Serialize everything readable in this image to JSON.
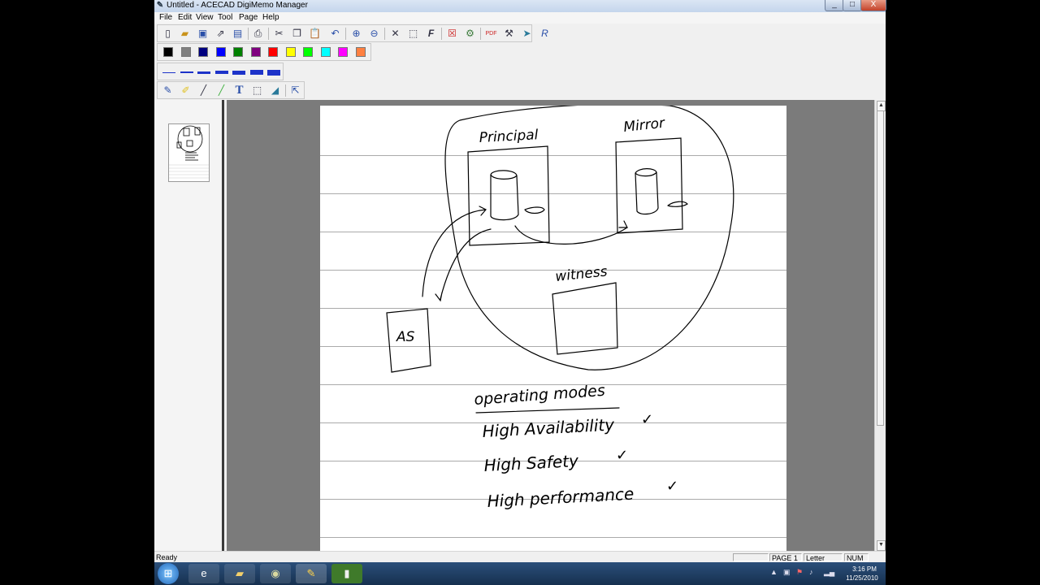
{
  "window": {
    "title": "Untitled - ACECAD DigiMemo Manager",
    "app_icon": "digimemo-app-icon",
    "controls": {
      "minimize": "_",
      "maximize": "□",
      "close": "X"
    }
  },
  "menu": [
    "File",
    "Edit",
    "View",
    "Tool",
    "Page",
    "Help"
  ],
  "toolbar_icons": [
    "new-icon",
    "open-icon",
    "save-icon",
    "export-icon",
    "convert-icon",
    "print-icon",
    "cut-icon",
    "copy-icon",
    "paste-icon",
    "undo-icon",
    "zoom-in-icon",
    "zoom-out-icon",
    "delete-icon",
    "select-icon",
    "font-icon",
    "close-doc-icon",
    "settings-icon",
    "pdf-icon",
    "tools-icon",
    "send-icon",
    "recognize-icon"
  ],
  "colors": [
    "#000000",
    "#808080",
    "#000080",
    "#0000ff",
    "#008000",
    "#800080",
    "#ff0000",
    "#ffff00",
    "#00ff00",
    "#00ffff",
    "#ff00ff",
    "#ff8040"
  ],
  "accent": "#1d33c9",
  "pen_widths": [
    1,
    2,
    3,
    4,
    5,
    6,
    7
  ],
  "draw_tools": [
    "pen-icon",
    "highlighter-icon",
    "line-icon",
    "marker-icon",
    "text-icon",
    "rect-select-icon",
    "eraser-icon",
    "pointer-icon"
  ],
  "draw_tool_text_label": "T",
  "thumbnail": {
    "page_number": 1
  },
  "canvas": {
    "labels": {
      "principal": "Principal",
      "mirror": "Mirror",
      "witness": "witness",
      "as": "AS",
      "modes_heading": "operating modes",
      "mode1": "High Availability",
      "mode2": "High Safety",
      "mode3": "High performance",
      "check": "✓"
    }
  },
  "status": {
    "text": "Ready",
    "page": "PAGE 1",
    "paper": "Letter",
    "num": "NUM"
  },
  "taskbar": {
    "apps": [
      "internet-explorer-icon",
      "folder-icon",
      "media-icon",
      "digimemo-icon",
      "app-icon"
    ],
    "time": "3:16 PM",
    "date": "11/25/2010"
  }
}
